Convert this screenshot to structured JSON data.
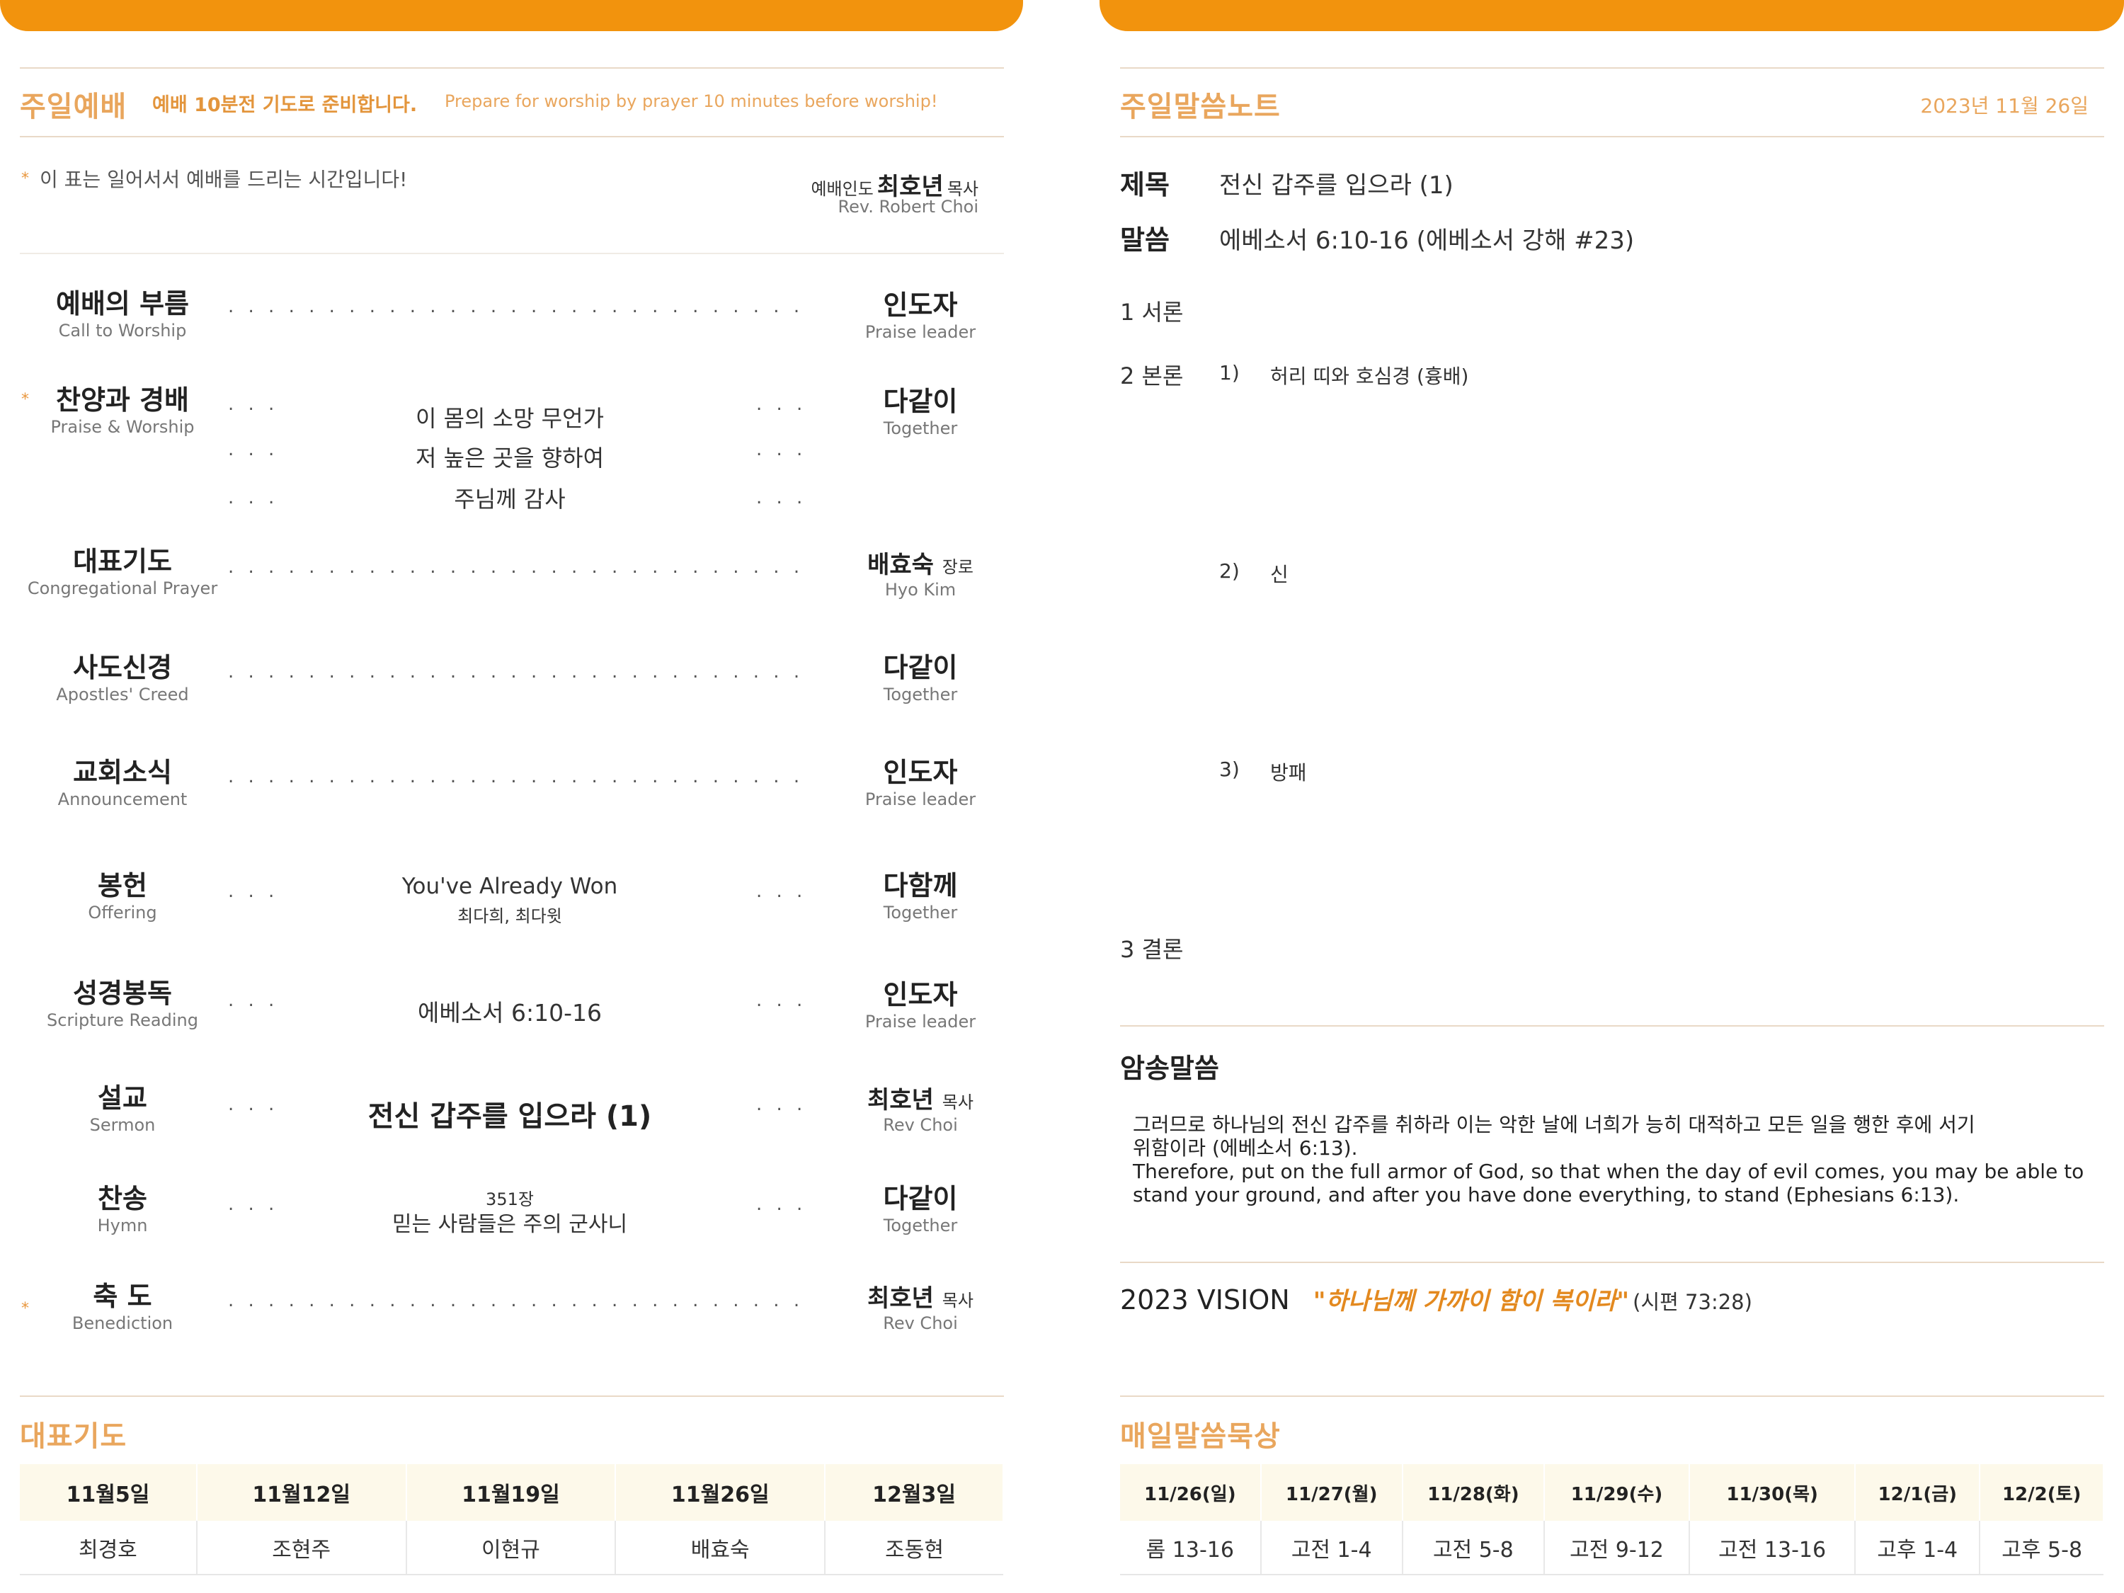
{
  "left": {
    "header": {
      "title": "주일예배",
      "subtitle_ko": "예배 10분전 기도로 준비합니다.",
      "subtitle_en": "Prepare for worship by prayer 10 minutes before worship!"
    },
    "standing_note": "이 표는 일어서서 예배를 드리는 시간입니다!",
    "leader": {
      "role": "예배인도",
      "name": "최호년",
      "title": "목사",
      "name_en": "Rev. Robert Choi"
    },
    "order": [
      {
        "ko": "예배의 부름",
        "en": "Call to Worship",
        "who": "인도자",
        "who_title": "",
        "who_en": "Praise leader"
      },
      {
        "ko": "찬양과 경배",
        "en": "Praise & Worship",
        "songs": [
          "이 몸의 소망 무언가",
          "저 높은 곳을 향하여",
          "주님께 감사"
        ],
        "who": "다같이",
        "who_title": "",
        "who_en": "Together"
      },
      {
        "ko": "대표기도",
        "en": "Congregational Prayer",
        "who": "배효숙",
        "who_title": "장로",
        "who_en": "Hyo Kim"
      },
      {
        "ko": "사도신경",
        "en": "Apostles' Creed",
        "who": "다같이",
        "who_title": "",
        "who_en": "Together"
      },
      {
        "ko": "교회소식",
        "en": "Announcement",
        "who": "인도자",
        "who_title": "",
        "who_en": "Praise leader"
      },
      {
        "ko": "봉헌",
        "en": "Offering",
        "mid_main": "You've Already Won",
        "mid_sub": "최다희, 최다윗",
        "who": "다함께",
        "who_title": "",
        "who_en": "Together"
      },
      {
        "ko": "성경봉독",
        "en": "Scripture Reading",
        "mid_main": "에베소서 6:10-16",
        "who": "인도자",
        "who_title": "",
        "who_en": "Praise leader"
      },
      {
        "ko": "설교",
        "en": "Sermon",
        "mid_main": "전신 갑주를 입으라 (1)",
        "who": "최호년",
        "who_title": "목사",
        "who_en": "Rev Choi"
      },
      {
        "ko": "찬송",
        "en": "Hymn",
        "mid_sub": "351장",
        "mid_main": "믿는 사람들은 주의 군사니",
        "who": "다같이",
        "who_title": "",
        "who_en": "Together"
      },
      {
        "ko": "축 도",
        "en": "Benediction",
        "who": "최호년",
        "who_title": "목사",
        "who_en": "Rev Choi"
      }
    ],
    "prayer": {
      "title": "대표기도",
      "dates": [
        "11월5일",
        "11월12일",
        "11월19일",
        "11월26일",
        "12월3일"
      ],
      "names": [
        "최경호",
        "조현주",
        "이현규",
        "배효숙",
        "조동현"
      ]
    },
    "star": "*",
    "dots_long": ". . . . . . . . . . . . . . . . . . . . . . . . . . . . . . . . . . . . . . . . . . . . . . . . . .",
    "dots_short": ". . . ."
  },
  "right": {
    "header": {
      "title": "주일말씀노트",
      "date": "2023년 11월 26일"
    },
    "sermon_title_label": "제목",
    "sermon_title": "전신 갑주를 입으라 (1)",
    "scripture_label": "말씀",
    "scripture": "에베소서 6:10-16 (에베소서 강해 #23)",
    "outline": {
      "intro": "1 서론",
      "body": "2 본론",
      "points": [
        {
          "num": "1)",
          "text": "허리 띠와 호심경 (흉배)"
        },
        {
          "num": "2)",
          "text": "신"
        },
        {
          "num": "3)",
          "text": "방패"
        }
      ],
      "conclusion": "3 결론"
    },
    "memory": {
      "title": "암송말씀",
      "ko_line1": "그러므로 하나님의 전신 갑주를 취하라 이는 악한 날에 너희가 능히 대적하고 모든 일을 행한 후에 서기",
      "ko_line2": "위함이라  (에베소서 6:13).",
      "en_line1": "Therefore, put on the full armor of God, so that when the day of evil comes, you may be able to",
      "en_line2": "stand your ground, and after you have done everything, to stand (Ephesians 6:13)."
    },
    "vision": {
      "label": "2023 VISION",
      "quote": "\"하나님께 가까이 함이 복이라\"",
      "ref": "(시편 73:28)"
    },
    "daily": {
      "title": "매일말씀묵상",
      "dates": [
        "11/26(일)",
        "11/27(월)",
        "11/28(화)",
        "11/29(수)",
        "11/30(목)",
        "12/1(금)",
        "12/2(토)"
      ],
      "readings": [
        "롬 13-16",
        "고전 1-4",
        "고전 5-8",
        "고전 9-12",
        "고전 13-16",
        "고후 1-4",
        "고후 5-8"
      ]
    }
  },
  "colors": {
    "accent": "#f2930d",
    "title_orange": "#e9a65d",
    "rule": "#e9d9c7"
  }
}
